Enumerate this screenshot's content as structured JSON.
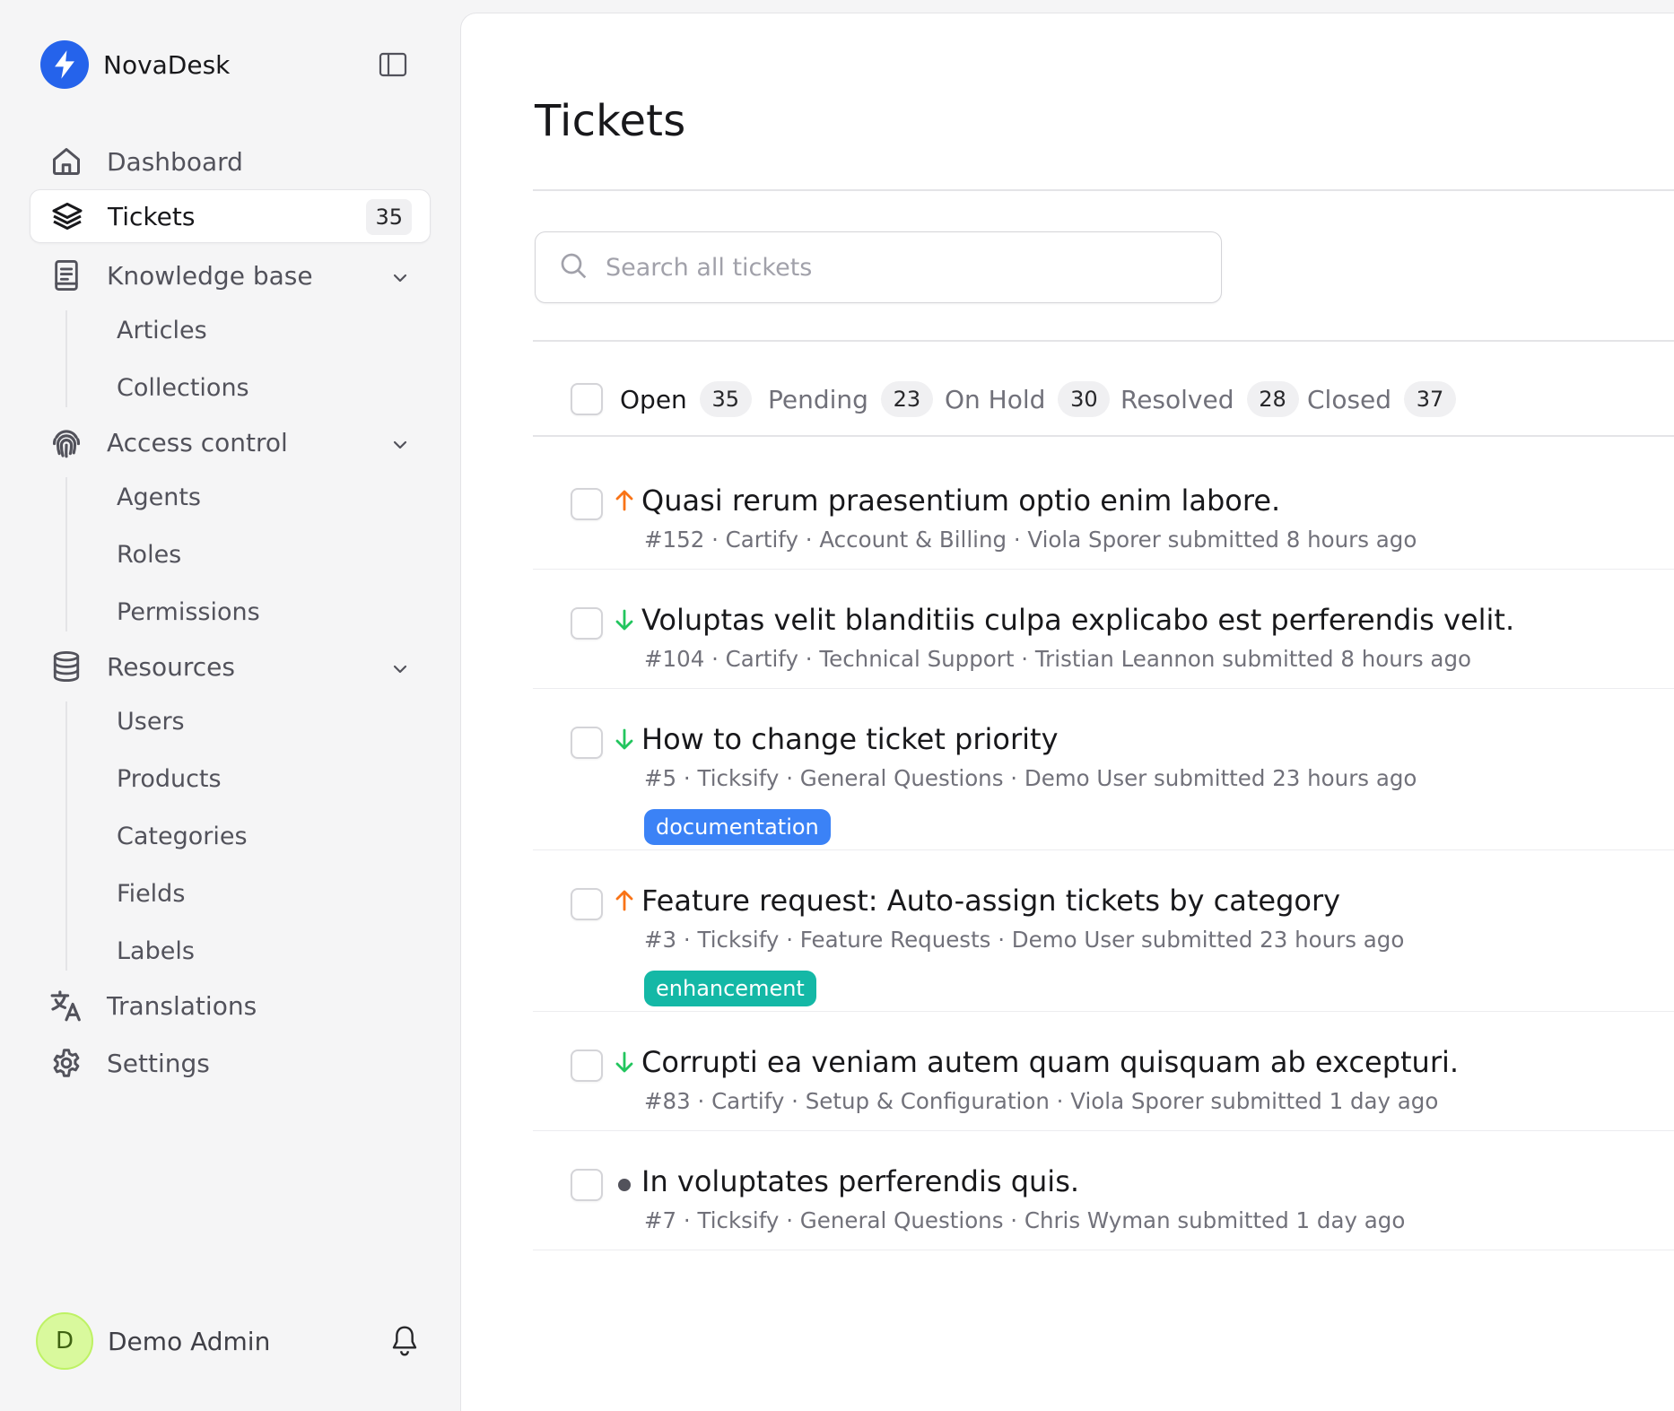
{
  "app": {
    "name": "NovaDesk",
    "colors": {
      "brand": "#2563eb",
      "priority_high": "#f97316",
      "priority_low": "#22c55e",
      "priority_normal": "#52525b"
    }
  },
  "sidebar": {
    "items": [
      {
        "key": "dashboard",
        "label": "Dashboard",
        "icon": "home-icon"
      },
      {
        "key": "tickets",
        "label": "Tickets",
        "icon": "layers-icon",
        "badge": "35",
        "active": true
      },
      {
        "key": "knowledge",
        "label": "Knowledge base",
        "icon": "book-icon",
        "children": [
          "Articles",
          "Collections"
        ]
      },
      {
        "key": "access",
        "label": "Access control",
        "icon": "fingerprint-icon",
        "children": [
          "Agents",
          "Roles",
          "Permissions"
        ]
      },
      {
        "key": "resources",
        "label": "Resources",
        "icon": "database-icon",
        "children": [
          "Users",
          "Products",
          "Categories",
          "Fields",
          "Labels"
        ]
      },
      {
        "key": "translations",
        "label": "Translations",
        "icon": "translate-icon"
      },
      {
        "key": "settings",
        "label": "Settings",
        "icon": "gear-icon"
      }
    ],
    "user": {
      "initial": "D",
      "name": "Demo Admin"
    }
  },
  "main": {
    "title": "Tickets",
    "search": {
      "placeholder": "Search all tickets",
      "value": ""
    },
    "tabs": [
      {
        "label": "Open",
        "count": "35",
        "active": true
      },
      {
        "label": "Pending",
        "count": "23"
      },
      {
        "label": "On Hold",
        "count": "30"
      },
      {
        "label": "Resolved",
        "count": "28"
      },
      {
        "label": "Closed",
        "count": "37"
      }
    ],
    "tickets": [
      {
        "priority": "high",
        "title": "Quasi rerum praesentium optio enim labore.",
        "meta": "#152 · Cartify · Account & Billing · Viola Sporer submitted 8 hours ago"
      },
      {
        "priority": "low",
        "title": "Voluptas velit blanditiis culpa explicabo est perferendis velit.",
        "meta": "#104 · Cartify · Technical Support · Tristian Leannon submitted 8 hours ago"
      },
      {
        "priority": "low",
        "title": "How to change ticket priority",
        "meta": "#5 · Ticksify · General Questions · Demo User submitted 23 hours ago",
        "label": "documentation",
        "label_color": "#3b82f6"
      },
      {
        "priority": "high",
        "title": "Feature request: Auto-assign tickets by category",
        "meta": "#3 · Ticksify · Feature Requests · Demo User submitted 23 hours ago",
        "label": "enhancement",
        "label_color": "#14b8a6"
      },
      {
        "priority": "low",
        "title": "Corrupti ea veniam autem quam quisquam ab excepturi.",
        "meta": "#83 · Cartify · Setup & Configuration · Viola Sporer submitted 1 day ago"
      },
      {
        "priority": "normal",
        "title": "In voluptates perferendis quis.",
        "meta": "#7 · Ticksify · General Questions · Chris Wyman submitted 1 day ago"
      }
    ]
  }
}
